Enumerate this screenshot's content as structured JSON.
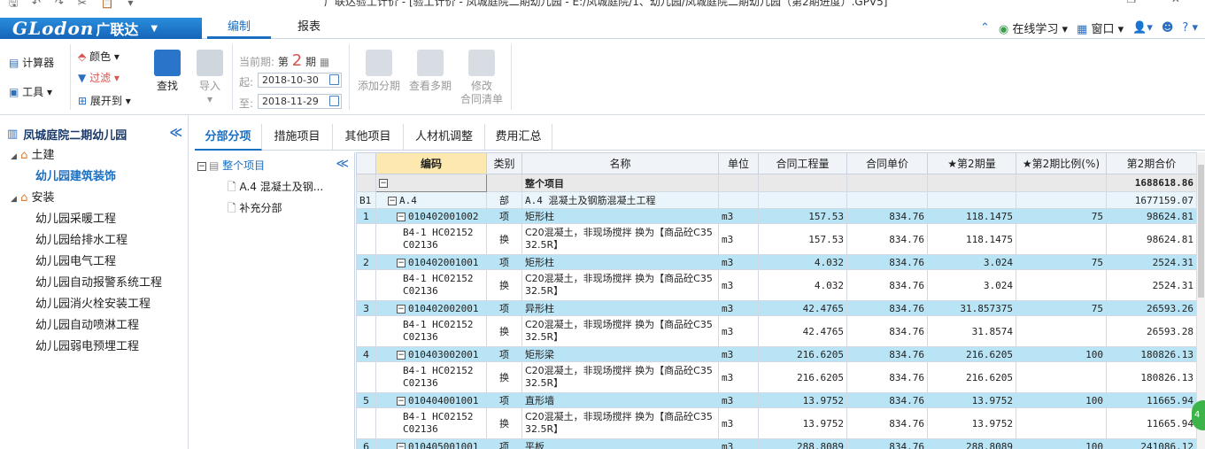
{
  "window": {
    "title": "广联达验工计价 - [验工计价 - 凤城庭院二期幼儿园 - E:/凤城庭院/1、幼儿园/凤城庭院二期幼儿园（第2期进度）.GPV5]",
    "qat": "🖫 ↶ ↷ ✂ 📋 ▾",
    "controls": "— ❐ ✕"
  },
  "logo": {
    "word": "GLodon",
    "cn": "广联达"
  },
  "ribbon": {
    "tab_edit": "编制",
    "tab_report": "报表",
    "online": "在线学习",
    "window": "窗口",
    "help": "?"
  },
  "toolbar": {
    "calculator": "计算器",
    "tools": "工具",
    "color": "颜色",
    "filter": "过滤",
    "expand": "展开到",
    "find": "查找",
    "import": "导入",
    "period_label": "当前期:",
    "period_pre": "第",
    "period_num": "2",
    "period_post": "期",
    "start_label": "起:",
    "start_date": "2018-10-30",
    "end_label": "至:",
    "end_date": "2018-11-29",
    "add_period": "添加分期",
    "view_multi": "查看多期",
    "modify_1": "修改",
    "modify_2": "合同清单"
  },
  "left": {
    "project": "凤城庭院二期幼儿园",
    "civil": "土建",
    "civil_child": "幼儿园建筑装饰",
    "install": "安装",
    "install_children": [
      "幼儿园采暖工程",
      "幼儿园给排水工程",
      "幼儿园电气工程",
      "幼儿园自动报警系统工程",
      "幼儿园消火栓安装工程",
      "幼儿园自动喷淋工程",
      "幼儿园弱电预埋工程"
    ]
  },
  "tabs": [
    "分部分项",
    "措施项目",
    "其他项目",
    "人材机调整",
    "费用汇总"
  ],
  "subtree": {
    "root": "整个项目",
    "a4": "A.4  混凝土及钢...",
    "extra": "补充分部"
  },
  "grid": {
    "headers": [
      "编码",
      "类别",
      "名称",
      "单位",
      "合同工程量",
      "合同单价",
      "★第2期量",
      "★第2期比例(%)",
      "第2期合价"
    ],
    "root": {
      "box": "−",
      "name": "整个项目",
      "total": "1688618.86"
    },
    "division": {
      "seq": "B1",
      "code": "A.4",
      "type": "部",
      "name": "A.4  混凝土及钢筋混凝土工程",
      "total": "1677159.07"
    },
    "items": [
      {
        "seq": "1",
        "code": "010402001002",
        "type": "项",
        "name": "矩形柱",
        "unit": "m3",
        "qty": "157.53",
        "price": "834.76",
        "pqty": "118.1475",
        "ratio": "75",
        "total": "98624.81",
        "sub": {
          "code1": "B4-1 HC02152",
          "code2": "C02136",
          "type": "换",
          "name": "C20混凝土，非现场搅拌 换为【商品砼C35 32.5R】",
          "unit": "m3",
          "qty": "157.53",
          "price": "834.76",
          "pqty": "118.1475",
          "ratio": "",
          "total": "98624.81"
        }
      },
      {
        "seq": "2",
        "code": "010402001001",
        "type": "项",
        "name": "矩形柱",
        "unit": "m3",
        "qty": "4.032",
        "price": "834.76",
        "pqty": "3.024",
        "ratio": "75",
        "total": "2524.31",
        "sub": {
          "code1": "B4-1 HC02152",
          "code2": "C02136",
          "type": "换",
          "name": "C20混凝土，非现场搅拌 换为【商品砼C35 32.5R】",
          "unit": "m3",
          "qty": "4.032",
          "price": "834.76",
          "pqty": "3.024",
          "ratio": "",
          "total": "2524.31"
        }
      },
      {
        "seq": "3",
        "code": "010402002001",
        "type": "项",
        "name": "异形柱",
        "unit": "m3",
        "qty": "42.4765",
        "price": "834.76",
        "pqty": "31.857375",
        "ratio": "75",
        "total": "26593.26",
        "sub": {
          "code1": "B4-1 HC02152",
          "code2": "C02136",
          "type": "换",
          "name": "C20混凝土，非现场搅拌 换为【商品砼C35 32.5R】",
          "unit": "m3",
          "qty": "42.4765",
          "price": "834.76",
          "pqty": "31.8574",
          "ratio": "",
          "total": "26593.28"
        }
      },
      {
        "seq": "4",
        "code": "010403002001",
        "type": "项",
        "name": "矩形梁",
        "unit": "m3",
        "qty": "216.6205",
        "price": "834.76",
        "pqty": "216.6205",
        "ratio": "100",
        "total": "180826.13",
        "sub": {
          "code1": "B4-1 HC02152",
          "code2": "C02136",
          "type": "换",
          "name": "C20混凝土，非现场搅拌 换为【商品砼C35 32.5R】",
          "unit": "m3",
          "qty": "216.6205",
          "price": "834.76",
          "pqty": "216.6205",
          "ratio": "",
          "total": "180826.13"
        }
      },
      {
        "seq": "5",
        "code": "010404001001",
        "type": "项",
        "name": "直形墙",
        "unit": "m3",
        "qty": "13.9752",
        "price": "834.76",
        "pqty": "13.9752",
        "ratio": "100",
        "total": "11665.94",
        "sub": {
          "code1": "B4-1 HC02152",
          "code2": "C02136",
          "type": "换",
          "name": "C20混凝土，非现场搅拌 换为【商品砼C35 32.5R】",
          "unit": "m3",
          "qty": "13.9752",
          "price": "834.76",
          "pqty": "13.9752",
          "ratio": "",
          "total": "11665.94"
        }
      },
      {
        "seq": "6",
        "code": "010405001001",
        "type": "项",
        "name": "平板",
        "unit": "m3",
        "qty": "288.8089",
        "price": "834.76",
        "pqty": "288.8089",
        "ratio": "100",
        "total": "241086.12",
        "sub": null
      }
    ]
  },
  "float": "4"
}
